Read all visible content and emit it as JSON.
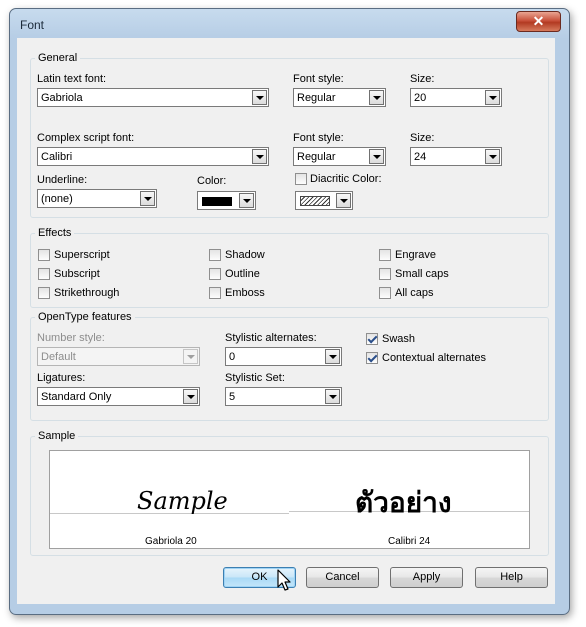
{
  "window": {
    "title": "Font",
    "close_glyph": "✕"
  },
  "general": {
    "legend": "General",
    "latin_font_label": "Latin text font:",
    "latin_font_value": "Gabriola",
    "latin_style_label": "Font style:",
    "latin_style_value": "Regular",
    "latin_size_label": "Size:",
    "latin_size_value": "20",
    "complex_font_label": "Complex script font:",
    "complex_font_value": "Calibri",
    "complex_style_label": "Font style:",
    "complex_style_value": "Regular",
    "complex_size_label": "Size:",
    "complex_size_value": "24",
    "underline_label": "Underline:",
    "underline_value": "(none)",
    "color_label": "Color:",
    "color_value": "#000000",
    "diacritic_label": "Diacritic Color:"
  },
  "effects": {
    "legend": "Effects",
    "items": [
      {
        "label": "Superscript",
        "checked": false
      },
      {
        "label": "Subscript",
        "checked": false
      },
      {
        "label": "Strikethrough",
        "checked": false
      },
      {
        "label": "Shadow",
        "checked": false
      },
      {
        "label": "Outline",
        "checked": false
      },
      {
        "label": "Emboss",
        "checked": false
      },
      {
        "label": "Engrave",
        "checked": false
      },
      {
        "label": "Small caps",
        "checked": false
      },
      {
        "label": "All caps",
        "checked": false
      }
    ]
  },
  "opentype": {
    "legend": "OpenType  features",
    "number_style_label": "Number style:",
    "number_style_value": "Default",
    "ligatures_label": "Ligatures:",
    "ligatures_value": "Standard Only",
    "stylistic_alt_label": "Stylistic alternates:",
    "stylistic_alt_value": "0",
    "stylistic_set_label": "Stylistic Set:",
    "stylistic_set_value": "5",
    "swash_label": "Swash",
    "swash_checked": true,
    "contextual_label": "Contextual alternates",
    "contextual_checked": true
  },
  "sample": {
    "legend": "Sample",
    "latin_text": "Sample",
    "complex_text": "ตัวอย่าง",
    "latin_caption": "Gabriola 20",
    "complex_caption": "Calibri 24"
  },
  "buttons": {
    "ok": "OK",
    "cancel": "Cancel",
    "apply": "Apply",
    "help": "Help"
  }
}
